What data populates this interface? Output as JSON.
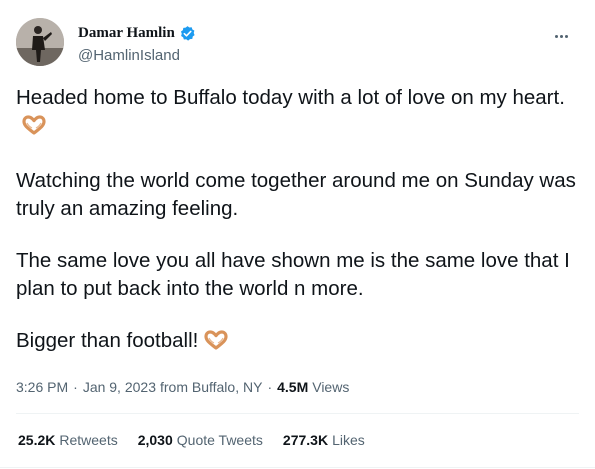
{
  "author": {
    "display_name": "Damar Hamlin",
    "handle": "@HamlinIsland"
  },
  "icons": {
    "verified": "verified-badge-icon",
    "more": "more-options-icon",
    "heart_hands": "heart-hands-emoji"
  },
  "colors": {
    "verified_blue": "#1d9bf0",
    "text_primary": "#0f1419",
    "text_secondary": "#536471",
    "emoji_tan": "#d9935a"
  },
  "tweet": {
    "paragraphs": [
      {
        "text": "Headed home to Buffalo today with a lot of love on my heart.",
        "emoji": true
      },
      {
        "text": "Watching the world come together around me on Sunday was truly an amazing feeling.",
        "emoji": false
      },
      {
        "text": "The same love you all have shown me is the same love that I plan to put back into the world n more.",
        "emoji": false
      },
      {
        "text": "Bigger than football!",
        "emoji": true
      }
    ]
  },
  "meta": {
    "time": "3:26 PM",
    "date": "Jan 9, 2023",
    "source": "from Buffalo, NY",
    "separator": "·",
    "views_count": "4.5M",
    "views_label": "Views"
  },
  "stats": {
    "retweets": {
      "count": "25.2K",
      "label": "Retweets"
    },
    "quotes": {
      "count": "2,030",
      "label": "Quote Tweets"
    },
    "likes": {
      "count": "277.3K",
      "label": "Likes"
    }
  }
}
